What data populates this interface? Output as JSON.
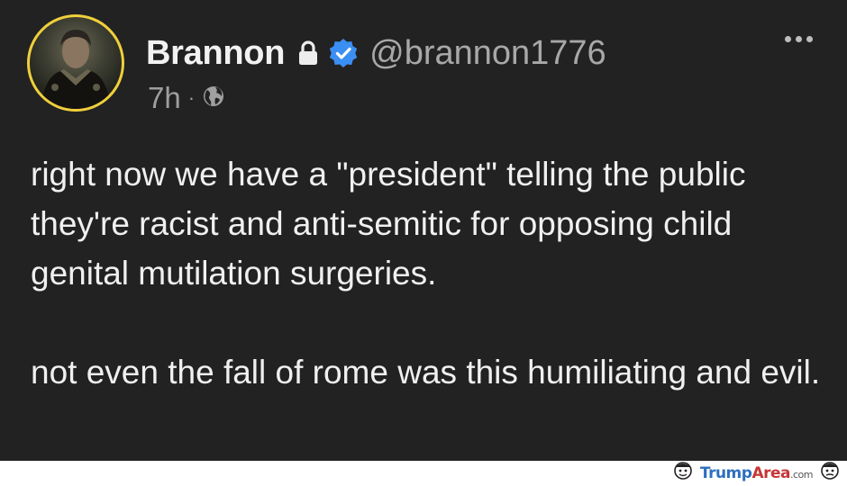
{
  "post": {
    "author": {
      "display_name": "Brannon",
      "handle": "@brannon1776",
      "avatar_icon": "user-avatar",
      "lock_icon": "lock-icon",
      "verified_icon": "verified-check-icon"
    },
    "meta": {
      "time": "7h",
      "separator": "·",
      "visibility_icon": "globe-icon"
    },
    "body": {
      "paragraph_1": "right now we have a \"president\" telling the public they're racist and anti-semitic for opposing child genital mutilation surgeries.",
      "paragraph_2": "not even the fall of rome was this humiliating and evil."
    },
    "menu_icon": "more-options-icon"
  },
  "watermark": {
    "brand_part_1": "Trump",
    "brand_part_2": "Area",
    "brand_part_3": ".com"
  },
  "colors": {
    "background": "#222222",
    "avatar_ring": "#f0cf3c",
    "verified": "#3b8ff3",
    "text": "#f0f0f0",
    "secondary_text": "#a8a8a8"
  }
}
